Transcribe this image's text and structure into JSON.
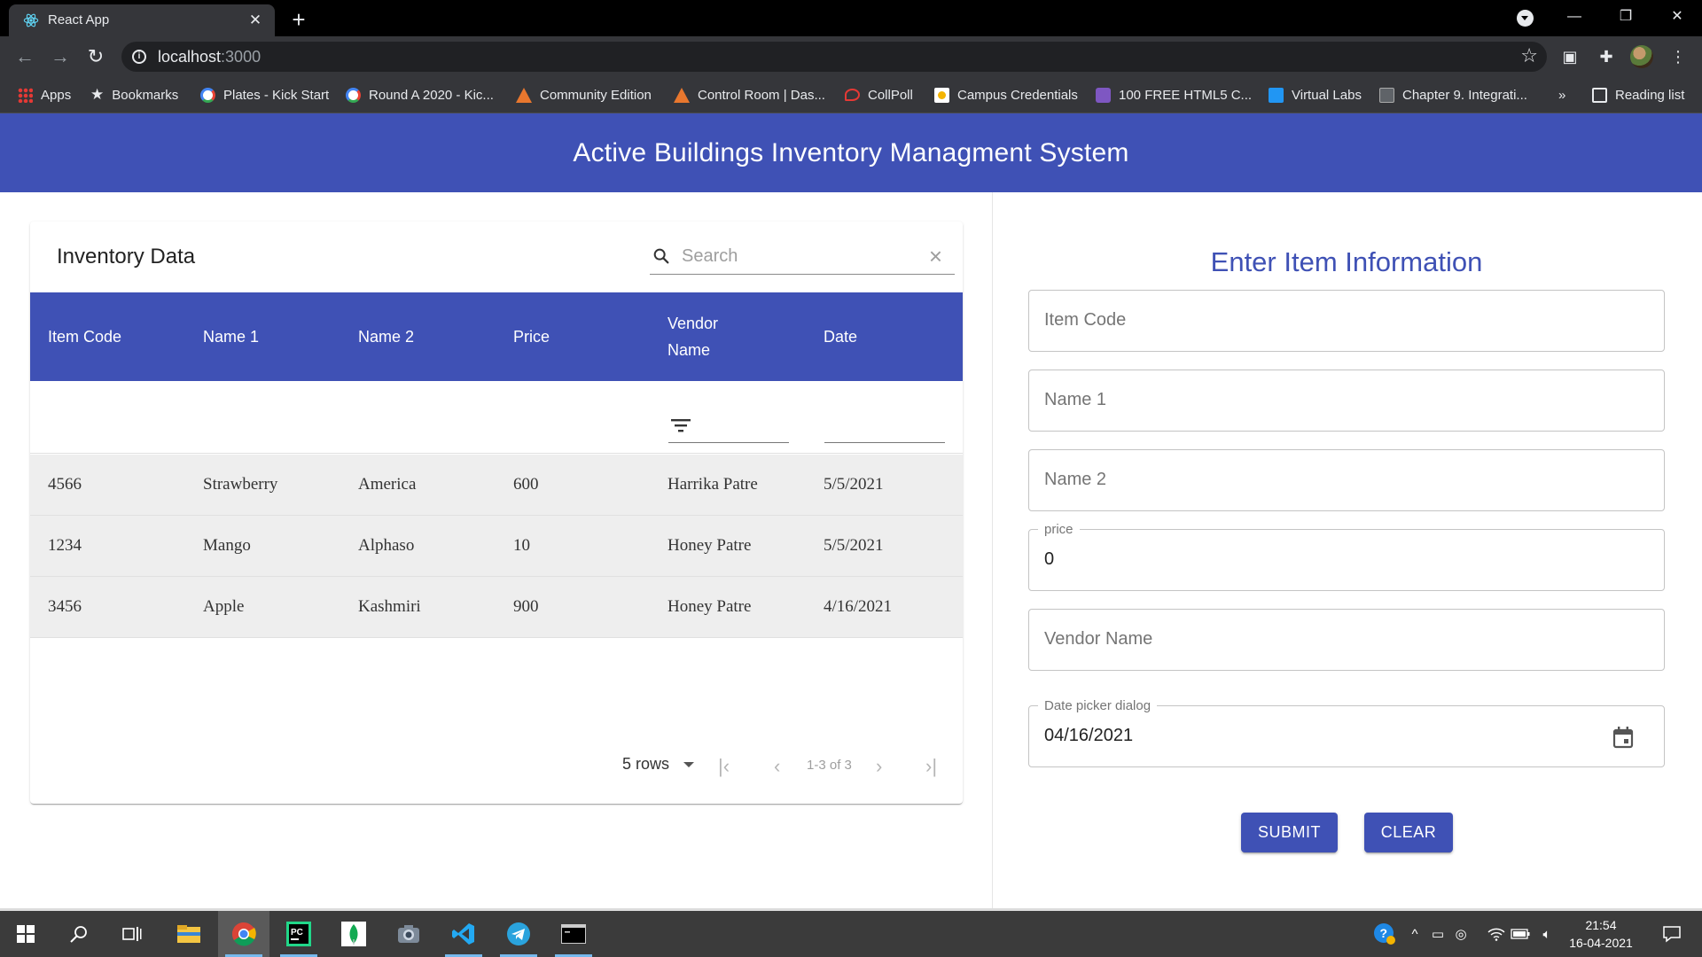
{
  "browser": {
    "tab_title": "React App",
    "url_host": "localhost",
    "url_port": ":3000",
    "bookmarks": [
      {
        "label": "Apps",
        "icon": "apps-grid-icon"
      },
      {
        "label": "Bookmarks",
        "icon": "star-icon"
      },
      {
        "label": "Plates - Kick Start",
        "icon": "google-icon"
      },
      {
        "label": "Round A 2020 - Kic...",
        "icon": "google-icon"
      },
      {
        "label": "Community Edition",
        "icon": "triangle-logo-icon"
      },
      {
        "label": "Control Room | Das...",
        "icon": "triangle-logo-icon"
      },
      {
        "label": "CollPoll",
        "icon": "chat-logo-icon"
      },
      {
        "label": "Campus Credentials",
        "icon": "campus-logo-icon"
      },
      {
        "label": "100 FREE HTML5 C...",
        "icon": "html5-logo-icon"
      },
      {
        "label": "Virtual Labs",
        "icon": "virtual-labs-icon"
      },
      {
        "label": "Chapter 9. Integrati...",
        "icon": "document-icon"
      }
    ],
    "more_bookmarks": "»",
    "reading_list": "Reading list"
  },
  "header": {
    "title": "Active Buildings Inventory Managment System"
  },
  "inventory": {
    "title": "Inventory Data",
    "search_placeholder": "Search",
    "columns": [
      {
        "label": "Item Code"
      },
      {
        "label": "Name 1"
      },
      {
        "label": "Name 2"
      },
      {
        "label": "Price"
      },
      {
        "label": "Vendor Name"
      },
      {
        "label": "Date"
      }
    ],
    "rows": [
      [
        "4566",
        "Strawberry",
        "America",
        "600",
        "Harrika Patre",
        "5/5/2021"
      ],
      [
        "1234",
        "Mango",
        "Alphaso",
        "10",
        "Honey Patre",
        "5/5/2021"
      ],
      [
        "3456",
        "Apple",
        "Kashmiri",
        "900",
        "Honey Patre",
        "4/16/2021"
      ]
    ],
    "pagination": {
      "rows_per_page": "5 rows",
      "range": "1-3 of 3"
    }
  },
  "form": {
    "title": "Enter Item Information",
    "item_code_placeholder": "Item Code",
    "name1_placeholder": "Name 1",
    "name2_placeholder": "Name 2",
    "price_label": "price",
    "price_value": "0",
    "vendor_placeholder": "Vendor Name",
    "date_label": "Date picker dialog",
    "date_value": "04/16/2021",
    "submit_label": "SUBMIT",
    "clear_label": "CLEAR"
  },
  "taskbar": {
    "time": "21:54",
    "date": "16-04-2021"
  },
  "colors": {
    "primary": "#3f51b5",
    "row_bg": "#eeeeee",
    "browser_dark": "#35363a"
  }
}
